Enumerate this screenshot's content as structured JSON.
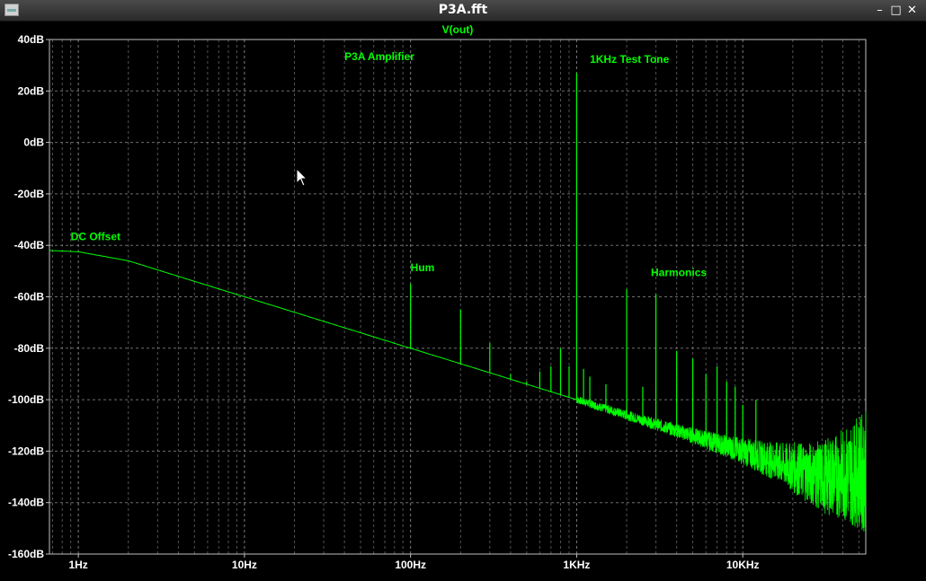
{
  "window": {
    "title": "P3A.fft",
    "minimize_glyph": "–",
    "maximize_glyph": "□",
    "close_glyph": "✕"
  },
  "colors": {
    "background": "#000000",
    "trace": "#00ff00",
    "grid": "#8a8a8a",
    "text": "#00ff00",
    "axis_text": "#ffffff"
  },
  "chart_data": {
    "type": "line",
    "title": "V(out)",
    "xscale": "log",
    "xlim": [
      0.67,
      55000
    ],
    "ylim": [
      -160,
      40
    ],
    "x_ticks": [
      {
        "value": 1,
        "label": "1Hz"
      },
      {
        "value": 10,
        "label": "10Hz"
      },
      {
        "value": 100,
        "label": "100Hz"
      },
      {
        "value": 1000,
        "label": "1KHz"
      },
      {
        "value": 10000,
        "label": "10KHz"
      }
    ],
    "y_ticks": [
      {
        "value": 40,
        "label": "40dB"
      },
      {
        "value": 20,
        "label": "20dB"
      },
      {
        "value": 0,
        "label": "0dB"
      },
      {
        "value": -20,
        "label": "-20dB"
      },
      {
        "value": -40,
        "label": "-40dB"
      },
      {
        "value": -60,
        "label": "-60dB"
      },
      {
        "value": -80,
        "label": "-80dB"
      },
      {
        "value": -100,
        "label": "-100dB"
      },
      {
        "value": -120,
        "label": "-120dB"
      },
      {
        "value": -140,
        "label": "-140dB"
      },
      {
        "value": -160,
        "label": "-160dB"
      }
    ],
    "grid": true,
    "noise_floor": [
      {
        "x": 0.67,
        "y": -42
      },
      {
        "x": 1,
        "y": -42.5
      },
      {
        "x": 2,
        "y": -46
      },
      {
        "x": 5,
        "y": -54
      },
      {
        "x": 10,
        "y": -60
      },
      {
        "x": 100,
        "y": -80
      },
      {
        "x": 1000,
        "y": -100
      },
      {
        "x": 10000,
        "y": -120
      },
      {
        "x": 30000,
        "y": -130
      },
      {
        "x": 55000,
        "y": -128
      }
    ],
    "peaks": [
      {
        "x": 100,
        "y": -55
      },
      {
        "x": 200,
        "y": -65
      },
      {
        "x": 300,
        "y": -78
      },
      {
        "x": 400,
        "y": -90
      },
      {
        "x": 500,
        "y": -93
      },
      {
        "x": 600,
        "y": -89
      },
      {
        "x": 700,
        "y": -87
      },
      {
        "x": 800,
        "y": -80
      },
      {
        "x": 900,
        "y": -87
      },
      {
        "x": 1000,
        "y": 27
      },
      {
        "x": 1100,
        "y": -88
      },
      {
        "x": 1200,
        "y": -91
      },
      {
        "x": 1500,
        "y": -94
      },
      {
        "x": 2000,
        "y": -57
      },
      {
        "x": 2500,
        "y": -95
      },
      {
        "x": 3000,
        "y": -59
      },
      {
        "x": 4000,
        "y": -81
      },
      {
        "x": 5000,
        "y": -84
      },
      {
        "x": 6000,
        "y": -90
      },
      {
        "x": 7000,
        "y": -87
      },
      {
        "x": 8000,
        "y": -93
      },
      {
        "x": 9000,
        "y": -95
      },
      {
        "x": 10000,
        "y": -102
      },
      {
        "x": 12000,
        "y": -100
      }
    ],
    "annotations": [
      {
        "text": "P3A Amplifier",
        "x": 40,
        "y": 32
      },
      {
        "text": "1KHz Test Tone",
        "x": 1200,
        "y": 31
      },
      {
        "text": "DC Offset",
        "x": 0.9,
        "y": -38
      },
      {
        "text": "Hum",
        "x": 100,
        "y": -50
      },
      {
        "text": "Harmonics",
        "x": 2800,
        "y": -52
      }
    ]
  }
}
